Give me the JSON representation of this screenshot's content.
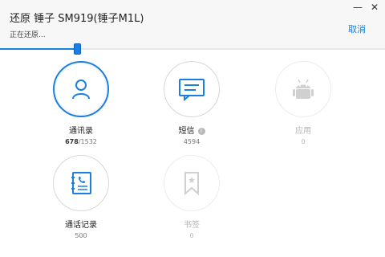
{
  "header": {
    "title": "还原 锤子 SM919(锤子M1L)",
    "status": "正在还原...",
    "cancel_label": "取消",
    "minimize_glyph": "—",
    "close_glyph": "✕"
  },
  "progress": {
    "fraction": 0.2
  },
  "colors": {
    "accent": "#1a7fe0",
    "disabled": "#d0d0d0"
  },
  "items": [
    {
      "key": "contacts",
      "label": "通讯录",
      "count_done": "678",
      "count_total": "/1532",
      "icon": "person-icon",
      "state": "active"
    },
    {
      "key": "sms",
      "label": "短信",
      "count": "4594",
      "icon": "message-icon",
      "state": "normal",
      "info": "i"
    },
    {
      "key": "apps",
      "label": "应用",
      "count": "0",
      "icon": "android-icon",
      "state": "disabled"
    },
    {
      "key": "calllog",
      "label": "通话记录",
      "count": "500",
      "icon": "call-log-icon",
      "state": "normal"
    },
    {
      "key": "bookmarks",
      "label": "书签",
      "count": "0",
      "icon": "bookmark-icon",
      "state": "disabled"
    }
  ]
}
